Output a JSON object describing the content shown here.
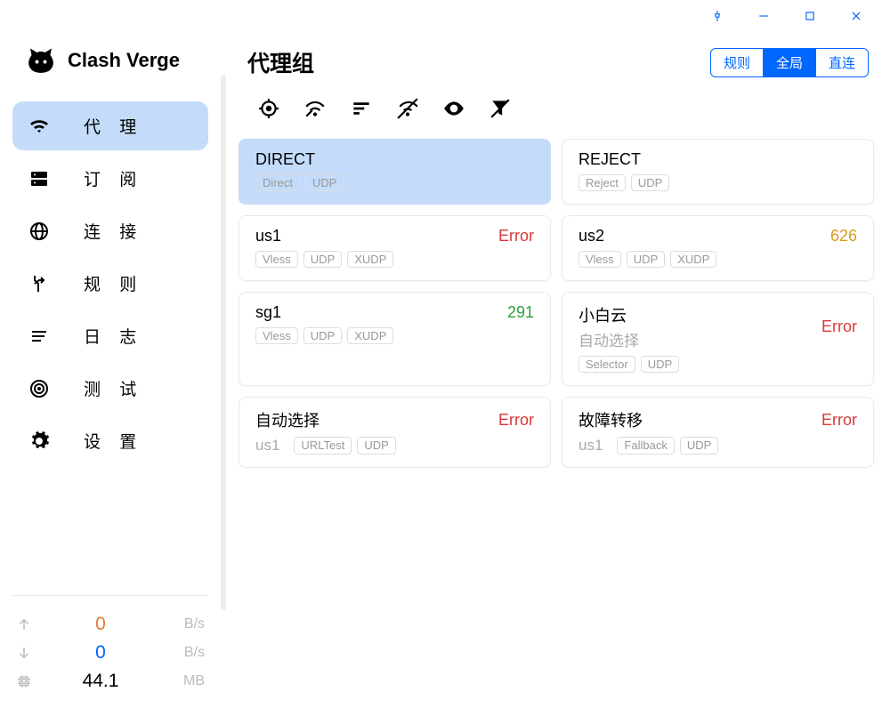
{
  "app": {
    "title": "Clash Verge"
  },
  "sidebar": {
    "items": [
      {
        "label": "代 理"
      },
      {
        "label": "订 阅"
      },
      {
        "label": "连 接"
      },
      {
        "label": "规 则"
      },
      {
        "label": "日 志"
      },
      {
        "label": "测 试"
      },
      {
        "label": "设 置"
      }
    ],
    "stats": {
      "upload": "0",
      "upload_unit": "B/s",
      "download": "0",
      "download_unit": "B/s",
      "mem": "44.1",
      "mem_unit": "MB"
    }
  },
  "page": {
    "title": "代理组"
  },
  "tabs": [
    {
      "label": "规则"
    },
    {
      "label": "全局"
    },
    {
      "label": "直连"
    }
  ],
  "cards": [
    {
      "name": "DIRECT",
      "sub": "",
      "badges": [
        "Direct",
        "UDP"
      ],
      "status": "",
      "status_class": ""
    },
    {
      "name": "REJECT",
      "sub": "",
      "badges": [
        "Reject",
        "UDP"
      ],
      "status": "",
      "status_class": ""
    },
    {
      "name": "us1",
      "sub": "",
      "badges": [
        "Vless",
        "UDP",
        "XUDP"
      ],
      "status": "Error",
      "status_class": "st-error"
    },
    {
      "name": "us2",
      "sub": "",
      "badges": [
        "Vless",
        "UDP",
        "XUDP"
      ],
      "status": "626",
      "status_class": "st-amber"
    },
    {
      "name": "sg1",
      "sub": "",
      "badges": [
        "Vless",
        "UDP",
        "XUDP"
      ],
      "status": "291",
      "status_class": "st-green"
    },
    {
      "name": "小白云",
      "sub": "自动选择",
      "badges": [
        "Selector",
        "UDP"
      ],
      "status": "Error",
      "status_class": "st-error",
      "layout": "sub_left"
    },
    {
      "name": "自动选择",
      "sub": "us1",
      "badges": [
        "URLTest",
        "UDP"
      ],
      "status": "Error",
      "status_class": "st-error",
      "layout": "sub_inline"
    },
    {
      "name": "故障转移",
      "sub": "us1",
      "badges": [
        "Fallback",
        "UDP"
      ],
      "status": "Error",
      "status_class": "st-error",
      "layout": "sub_inline"
    }
  ]
}
